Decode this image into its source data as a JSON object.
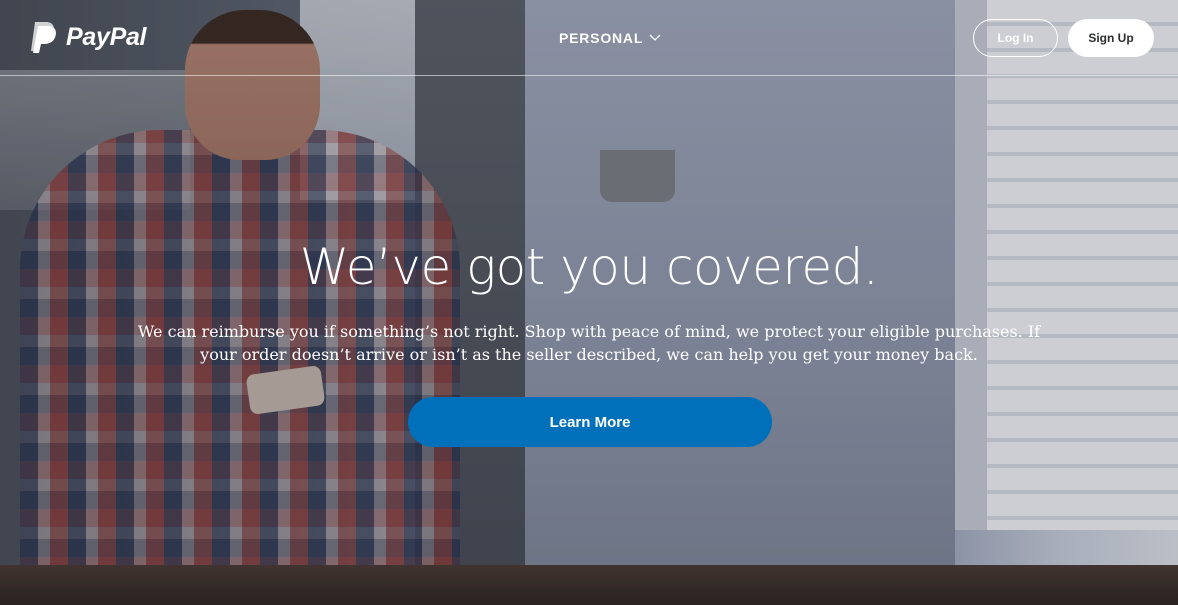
{
  "header": {
    "brand": "PayPal",
    "nav_personal": "PERSONAL",
    "login_label": "Log In",
    "signup_label": "Sign Up"
  },
  "hero": {
    "headline": "We’ve got you covered.",
    "subtext": "We can reimburse you if something’s not right. Shop with peace of mind, we protect your eligible purchases. If your order doesn’t arrive or isn’t as the seller described, we can help you get your money back.",
    "cta_label": "Learn More"
  },
  "icons": {
    "logo": "paypal-logo-icon",
    "nav": "chevron-down-icon"
  },
  "colors": {
    "cta": "#0070ba",
    "text": "#ffffff",
    "signup_bg": "#ffffff"
  }
}
